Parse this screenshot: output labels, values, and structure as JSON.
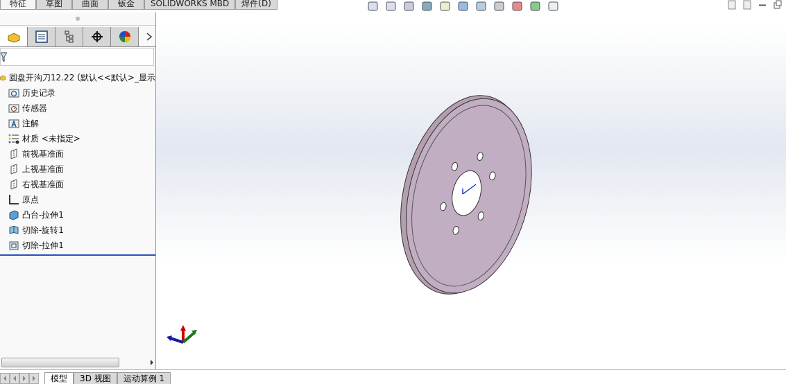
{
  "command_tabs": [
    {
      "label": "特征",
      "selected": true
    },
    {
      "label": "草图",
      "selected": false
    },
    {
      "label": "曲面",
      "selected": false
    },
    {
      "label": "钣金",
      "selected": false
    },
    {
      "label": "SOLIDWORKS MBD",
      "selected": false
    },
    {
      "label": "焊件(D)",
      "selected": false
    }
  ],
  "panel_tabs": [
    {
      "kind": "features",
      "selected": true
    },
    {
      "kind": "properties",
      "selected": false
    },
    {
      "kind": "configurations",
      "selected": false
    },
    {
      "kind": "dimxpert",
      "selected": false
    },
    {
      "kind": "display",
      "selected": false
    }
  ],
  "tree": {
    "label": "圆盘开沟刀12.22  (默认<<默认>_显示",
    "kind": "part",
    "children": [
      {
        "label": "历史记录",
        "kind": "history"
      },
      {
        "label": "传感器",
        "kind": "sensor"
      },
      {
        "label": "注解",
        "kind": "annotation"
      },
      {
        "label": "材质 <未指定>",
        "kind": "material"
      },
      {
        "label": "前视基准面",
        "kind": "plane"
      },
      {
        "label": "上视基准面",
        "kind": "plane"
      },
      {
        "label": "右视基准面",
        "kind": "plane"
      },
      {
        "label": "原点",
        "kind": "origin"
      },
      {
        "label": "凸台-拉伸1",
        "kind": "boss"
      },
      {
        "label": "切除-旋转1",
        "kind": "revolve-cut"
      },
      {
        "label": "切除-拉伸1",
        "kind": "extrude-cut"
      }
    ]
  },
  "bottom_tabs": [
    {
      "label": "模型",
      "selected": true
    },
    {
      "label": "3D 视图",
      "selected": false
    },
    {
      "label": "运动算例 1",
      "selected": false
    }
  ]
}
